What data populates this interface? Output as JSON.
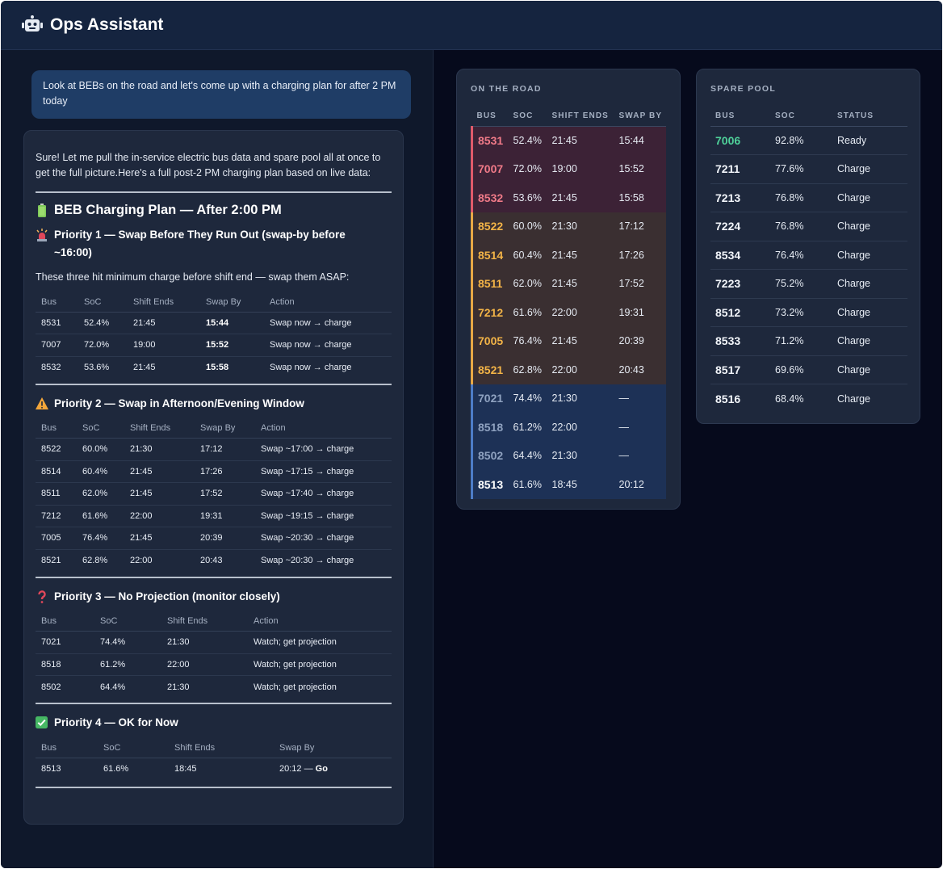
{
  "header": {
    "title": "Ops Assistant",
    "icon": "robot-icon"
  },
  "chat": {
    "user_message": "Look at BEBs on the road and let's come up with a charging plan for after 2 PM today",
    "reply": {
      "intro": "Sure! Let me pull the in-service electric bus data and spare pool all at once to get the full picture.Here's a full post-2 PM charging plan based on live data:",
      "plan_title": "BEB Charging Plan — After 2:00 PM",
      "priority1": {
        "title": "Priority 1 — Swap Before They Run Out (swap-by before ~16:00)",
        "note": "These three hit minimum charge before shift end — swap them ASAP:",
        "headers": [
          "Bus",
          "SoC",
          "Shift Ends",
          "Swap By",
          "Action"
        ],
        "rows": [
          [
            "8531",
            "52.4%",
            "21:45",
            "15:44",
            "Swap now → charge"
          ],
          [
            "7007",
            "72.0%",
            "19:00",
            "15:52",
            "Swap now → charge"
          ],
          [
            "8532",
            "53.6%",
            "21:45",
            "15:58",
            "Swap now → charge"
          ]
        ]
      },
      "priority2": {
        "title": "Priority 2 — Swap in Afternoon/Evening Window",
        "headers": [
          "Bus",
          "SoC",
          "Shift Ends",
          "Swap By",
          "Action"
        ],
        "rows": [
          [
            "8522",
            "60.0%",
            "21:30",
            "17:12",
            "Swap ~17:00 → charge"
          ],
          [
            "8514",
            "60.4%",
            "21:45",
            "17:26",
            "Swap ~17:15 → charge"
          ],
          [
            "8511",
            "62.0%",
            "21:45",
            "17:52",
            "Swap ~17:40 → charge"
          ],
          [
            "7212",
            "61.6%",
            "22:00",
            "19:31",
            "Swap ~19:15 → charge"
          ],
          [
            "7005",
            "76.4%",
            "21:45",
            "20:39",
            "Swap ~20:30 → charge"
          ],
          [
            "8521",
            "62.8%",
            "22:00",
            "20:43",
            "Swap ~20:30 → charge"
          ]
        ]
      },
      "priority3": {
        "title": "Priority 3 — No Projection (monitor closely)",
        "headers": [
          "Bus",
          "SoC",
          "Shift Ends",
          "Action"
        ],
        "rows": [
          [
            "7021",
            "74.4%",
            "21:30",
            "Watch; get projection"
          ],
          [
            "8518",
            "61.2%",
            "22:00",
            "Watch; get projection"
          ],
          [
            "8502",
            "64.4%",
            "21:30",
            "Watch; get projection"
          ]
        ]
      },
      "priority4": {
        "title": "Priority 4 — OK for Now",
        "headers": [
          "Bus",
          "SoC",
          "Shift Ends",
          "Swap By"
        ],
        "rows": [
          [
            "8513",
            "61.6%",
            "18:45",
            "20:12 — ",
            "Go"
          ]
        ]
      }
    }
  },
  "on_the_road": {
    "title": "ON THE ROAD",
    "headers": [
      "BUS",
      "SOC",
      "SHIFT ENDS",
      "SWAP BY"
    ],
    "rows": [
      {
        "bus": "8531",
        "soc": "52.4%",
        "shift_ends": "21:45",
        "swap_by": "15:44",
        "status": "red"
      },
      {
        "bus": "7007",
        "soc": "72.0%",
        "shift_ends": "19:00",
        "swap_by": "15:52",
        "status": "red"
      },
      {
        "bus": "8532",
        "soc": "53.6%",
        "shift_ends": "21:45",
        "swap_by": "15:58",
        "status": "red"
      },
      {
        "bus": "8522",
        "soc": "60.0%",
        "shift_ends": "21:30",
        "swap_by": "17:12",
        "status": "amber"
      },
      {
        "bus": "8514",
        "soc": "60.4%",
        "shift_ends": "21:45",
        "swap_by": "17:26",
        "status": "amber"
      },
      {
        "bus": "8511",
        "soc": "62.0%",
        "shift_ends": "21:45",
        "swap_by": "17:52",
        "status": "amber"
      },
      {
        "bus": "7212",
        "soc": "61.6%",
        "shift_ends": "22:00",
        "swap_by": "19:31",
        "status": "amber"
      },
      {
        "bus": "7005",
        "soc": "76.4%",
        "shift_ends": "21:45",
        "swap_by": "20:39",
        "status": "amber"
      },
      {
        "bus": "8521",
        "soc": "62.8%",
        "shift_ends": "22:00",
        "swap_by": "20:43",
        "status": "amber"
      },
      {
        "bus": "7021",
        "soc": "74.4%",
        "shift_ends": "21:30",
        "swap_by": "—",
        "status": "blue"
      },
      {
        "bus": "8518",
        "soc": "61.2%",
        "shift_ends": "22:00",
        "swap_by": "—",
        "status": "blue"
      },
      {
        "bus": "8502",
        "soc": "64.4%",
        "shift_ends": "21:30",
        "swap_by": "—",
        "status": "blue"
      },
      {
        "bus": "8513",
        "soc": "61.6%",
        "shift_ends": "18:45",
        "swap_by": "20:12",
        "status": "blue"
      }
    ],
    "colors": {
      "red": "#e05a6a",
      "amber": "#e8a845",
      "blue": "#4d7dc8"
    }
  },
  "spare_pool": {
    "title": "SPARE POOL",
    "headers": [
      "BUS",
      "SOC",
      "STATUS"
    ],
    "rows": [
      {
        "bus": "7006",
        "soc": "92.8%",
        "status": "Ready"
      },
      {
        "bus": "7211",
        "soc": "77.6%",
        "status": "Charge"
      },
      {
        "bus": "7213",
        "soc": "76.8%",
        "status": "Charge"
      },
      {
        "bus": "7224",
        "soc": "76.8%",
        "status": "Charge"
      },
      {
        "bus": "8534",
        "soc": "76.4%",
        "status": "Charge"
      },
      {
        "bus": "7223",
        "soc": "75.2%",
        "status": "Charge"
      },
      {
        "bus": "8512",
        "soc": "73.2%",
        "status": "Charge"
      },
      {
        "bus": "8533",
        "soc": "71.2%",
        "status": "Charge"
      },
      {
        "bus": "8517",
        "soc": "69.6%",
        "status": "Charge"
      },
      {
        "bus": "8516",
        "soc": "68.4%",
        "status": "Charge"
      }
    ],
    "ready_color": "#4fd19a"
  }
}
